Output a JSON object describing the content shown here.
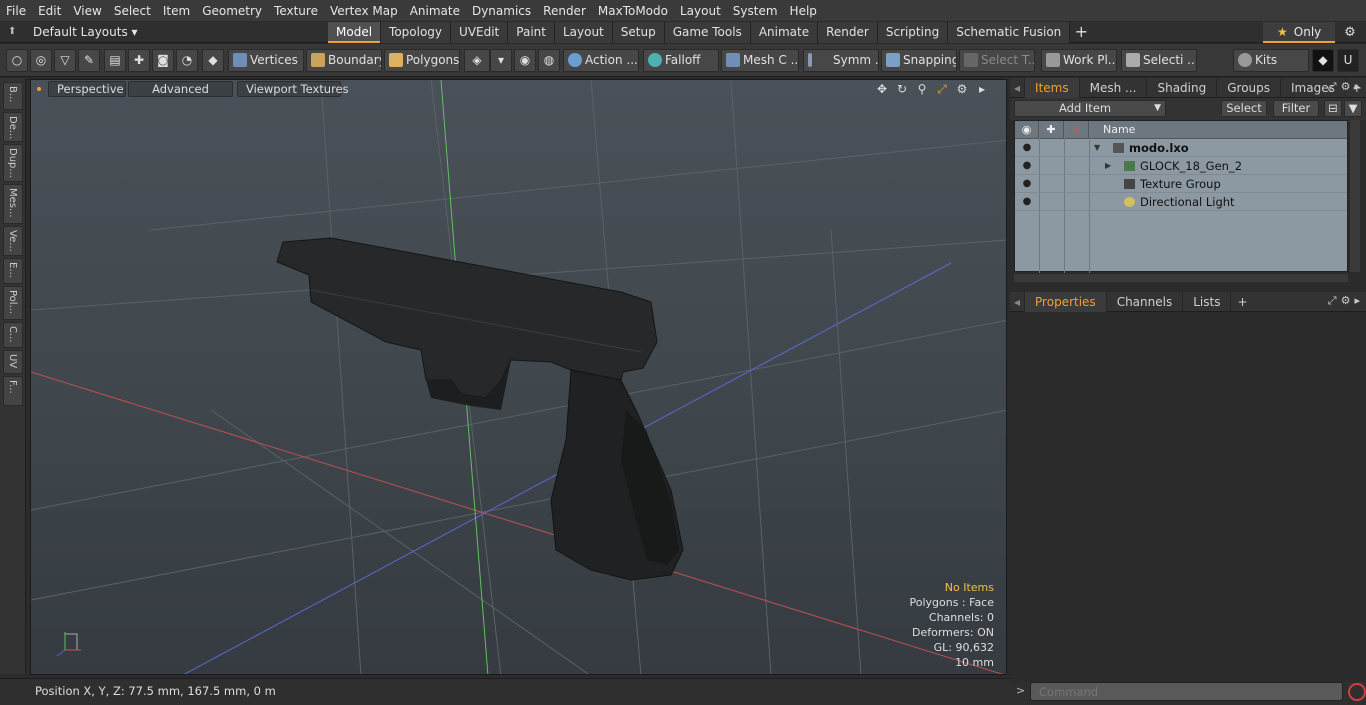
{
  "menu": [
    "File",
    "Edit",
    "View",
    "Select",
    "Item",
    "Geometry",
    "Texture",
    "Vertex Map",
    "Animate",
    "Dynamics",
    "Render",
    "MaxToModo",
    "Layout",
    "System",
    "Help"
  ],
  "layout": {
    "selector": "Default Layouts ▾"
  },
  "tabs": [
    "Model",
    "Topology",
    "UVEdit",
    "Paint",
    "Layout",
    "Setup",
    "Game Tools",
    "Animate",
    "Render",
    "Scripting",
    "Schematic Fusion"
  ],
  "tab_add": "+",
  "only_label": "Only",
  "toolbar": {
    "vertices": "Vertices",
    "boundary": "Boundary",
    "polygons": "Polygons",
    "action": "Action ...",
    "falloff": "Falloff",
    "mesh": "Mesh C ...",
    "symm": "Symm ...",
    "snapping": "Snapping",
    "select_t": "Select T...",
    "work_pl": "Work Pl...",
    "selecti": "Selecti ...",
    "kits": "Kits"
  },
  "left_tabs": [
    "B...",
    "De...",
    "Dup...",
    "Mes...",
    "Ve...",
    "E...",
    "Pol...",
    "C...",
    "UV",
    "F..."
  ],
  "viewport": {
    "perspective": "Perspective",
    "advanced": "Advanced",
    "textures": "Viewport Textures",
    "info": {
      "no_items": "No Items",
      "polygons": "Polygons : Face",
      "channels": "Channels: 0",
      "deformers": "Deformers: ON",
      "gl": "GL: 90,632",
      "scale": "10 mm"
    }
  },
  "status": {
    "position": "Position X, Y, Z:   77.5 mm, 167.5 mm, 0 m"
  },
  "command": {
    "placeholder": "Command"
  },
  "panel_top": {
    "tabs": [
      "Items",
      "Mesh ...",
      "Shading",
      "Groups",
      "Images"
    ],
    "add": "+"
  },
  "items_tools": {
    "add_item": "Add Item",
    "select": "Select",
    "filter": "Filter"
  },
  "tree": {
    "header_name": "Name",
    "rows": [
      {
        "label": "modo.lxo"
      },
      {
        "label": "GLOCK_18_Gen_2"
      },
      {
        "label": "Texture Group"
      },
      {
        "label": "Directional Light"
      }
    ]
  },
  "panel_bottom": {
    "tabs": [
      "Properties",
      "Channels",
      "Lists"
    ],
    "add": "+"
  },
  "colors": {
    "accent": "#e8a33a",
    "highlight": "#f0c040",
    "record": "#d04040"
  }
}
